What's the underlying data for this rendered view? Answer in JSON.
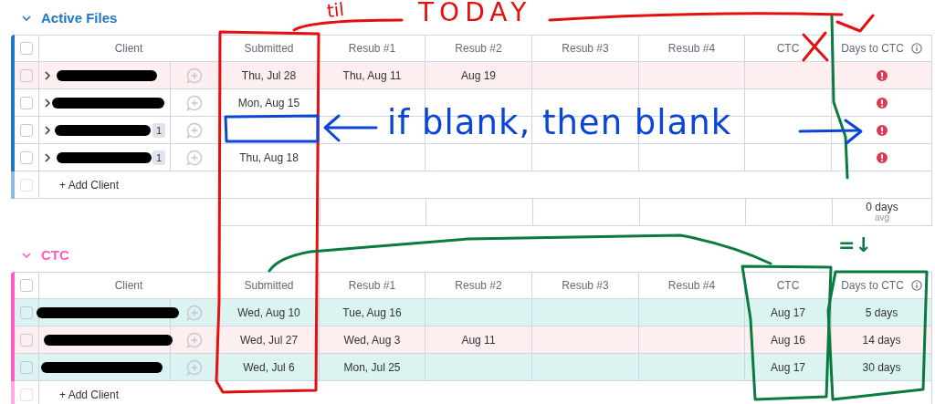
{
  "groups": [
    {
      "title": "Active Files",
      "color": "#1f76c2",
      "header_checked": false,
      "columns": [
        "Client",
        "Submitted",
        "Resub #1",
        "Resub #2",
        "Resub #3",
        "Resub #4",
        "CTC",
        "Days to CTC"
      ],
      "rows": [
        {
          "color": "#fdeeef",
          "checked": false,
          "expandable": true,
          "redacted": true,
          "dates": {
            "submitted": "Thu, Jul 28",
            "resub_1": "Thu, Aug 11",
            "resub_2": "Aug 19"
          },
          "alert": true
        },
        {
          "color": "#ffffff",
          "checked": false,
          "expandable": true,
          "redacted": true,
          "dates": {
            "submitted": "Mon, Aug 15"
          },
          "alert": true
        },
        {
          "color": "#ffffff",
          "checked": false,
          "expandable": true,
          "redacted": true,
          "subitems": "1",
          "alert": true
        },
        {
          "color": "#ffffff",
          "checked": false,
          "expandable": true,
          "redacted": true,
          "subitems": "1",
          "dates": {
            "submitted": "Thu, Aug 18"
          },
          "alert": true
        }
      ],
      "add_label": "+ Add Client",
      "add_checked": false,
      "summary": {
        "value": "0 days",
        "label": "avg"
      }
    },
    {
      "title": "CTC",
      "color": "#ff5ac4",
      "header_checked": false,
      "columns": [
        "Client",
        "Submitted",
        "Resub #1",
        "Resub #2",
        "Resub #3",
        "Resub #4",
        "CTC",
        "Days to CTC"
      ],
      "rows": [
        {
          "color": "#dcf4f1",
          "checked": false,
          "expandable": false,
          "redacted": true,
          "dates": {
            "submitted": "Wed, Aug 10",
            "resub_1": "Tue, Aug 16",
            "ctc": "Aug 17"
          },
          "alert": false,
          "days_to_ctc": "5 days"
        },
        {
          "color": "#fdeeef",
          "checked": false,
          "expandable": false,
          "redacted": true,
          "dates": {
            "submitted": "Wed, Jul 27",
            "resub_1": "Wed, Aug 3",
            "resub_2": "Aug 11",
            "ctc": "Aug 16"
          },
          "alert": false,
          "days_to_ctc": "14 days"
        },
        {
          "color": "#dcf4f1",
          "checked": false,
          "expandable": false,
          "redacted": true,
          "dates": {
            "submitted": "Wed, Jul 6",
            "resub_1": "Mon, Jul 25",
            "ctc": "Aug 17"
          },
          "alert": false,
          "days_to_ctc": "30 days"
        }
      ],
      "add_label": "+ Add Client",
      "add_checked": false
    }
  ],
  "annotations": [
    {
      "text": "til",
      "color": "#e3100f"
    },
    {
      "text": "TODAY",
      "color": "#e3100f"
    },
    {
      "text": "if blank, then blank",
      "color": "#0a45d6"
    },
    {
      "text": "=↓",
      "color": "#0b7a3e"
    }
  ]
}
